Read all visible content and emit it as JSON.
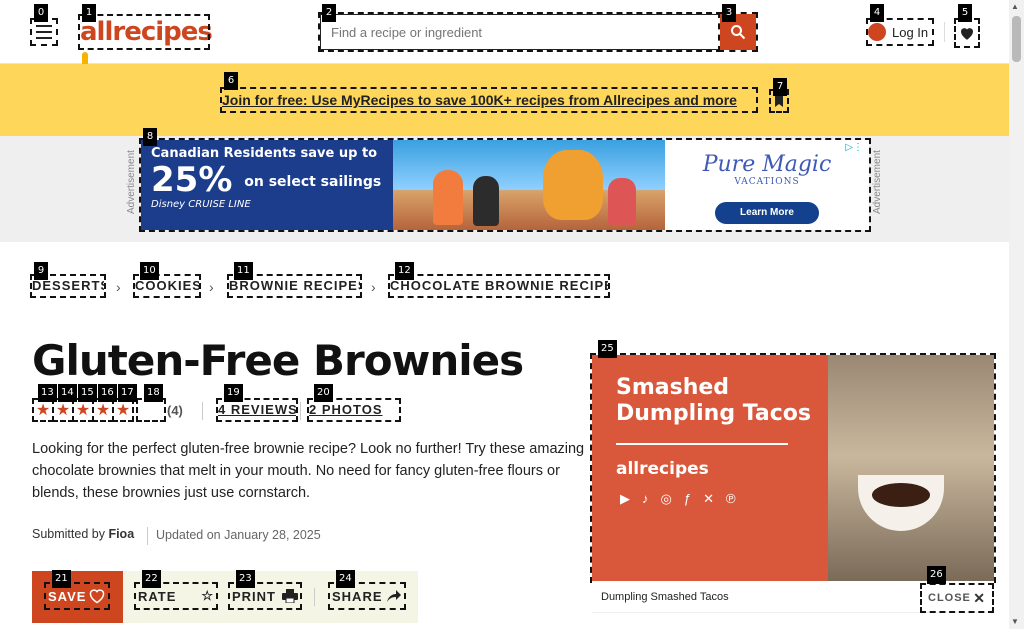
{
  "header": {
    "logo_text": "allrecipes",
    "search_placeholder": "Find a recipe or ingredient",
    "login_label": "Log In"
  },
  "promo": {
    "text": "Join for free: Use MyRecipes to save 100K+ recipes from Allrecipes and more"
  },
  "ad": {
    "label": "Advertisement",
    "line1": "Canadian Residents save up to",
    "percent": "25%",
    "percent_suffix": "on select sailings",
    "brand_left": "Disney CRUISE LINE",
    "brand_right": "Pure Magic",
    "brand_right_sub": "VACATIONS",
    "cta": "Learn More"
  },
  "breadcrumb": [
    "DESSERTS",
    "COOKIES",
    "BROWNIE RECIPES",
    "CHOCOLATE BROWNIE RECIPES"
  ],
  "recipe": {
    "title": "Gluten-Free Brownies",
    "rating_value": 4.5,
    "rating_count": "(4)",
    "rate_label": "RATE",
    "reviews_label": "4 REVIEWS",
    "photos_label": "2 PHOTOS",
    "description_lines": [
      "Looking for the perfect gluten-free brownie recipe? Look no further! Try these amazing",
      "chocolate brownies that melt in your mouth. No need for fancy gluten-free flours or",
      "blends, these brownies just use cornstarch."
    ],
    "submitted_by_label": "Submitted by",
    "author": "Fioa",
    "updated": "Updated on January 28, 2025"
  },
  "actions": {
    "save": "SAVE",
    "rate": "RATE",
    "print": "PRINT",
    "share": "SHARE"
  },
  "video": {
    "title_lines": [
      "Smashed",
      "Dumpling Tacos"
    ],
    "brand": "allrecipes",
    "caption": "Dumpling Smashed Tacos",
    "close_label": "CLOSE",
    "socials": [
      "youtube-icon",
      "tiktok-icon",
      "instagram-icon",
      "facebook-icon",
      "x-icon",
      "pinterest-icon"
    ]
  },
  "colors": {
    "brand": "#ce4620",
    "promo_bg": "#fdd65a",
    "star": "#ce4620",
    "video_bg": "#d9583b"
  }
}
